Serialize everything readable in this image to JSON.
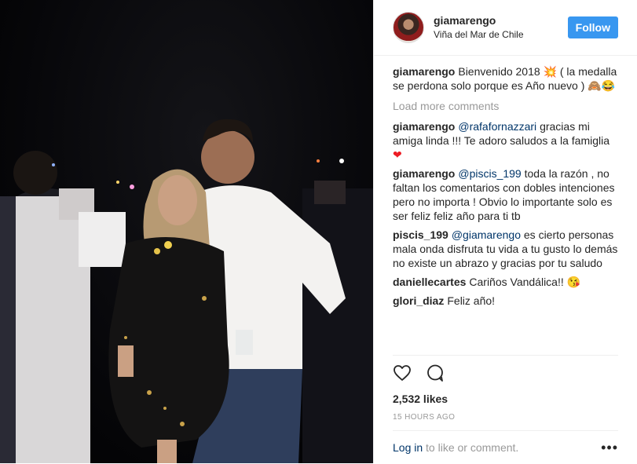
{
  "header": {
    "username": "giamarengo",
    "location": "Viña del Mar de Chile",
    "follow_label": "Follow"
  },
  "caption": {
    "username": "giamarengo",
    "text": "Bienvenido 2018 💥 ( la medalla se perdona solo porque es Año nuevo ) 🙈😂"
  },
  "load_more": "Load more comments",
  "comments": [
    {
      "username": "giamarengo",
      "mention": "@rafafornazzari",
      "text": "gracias mi amiga linda !!! Te adoro saludos a la famiglia",
      "emoji": "❤"
    },
    {
      "username": "giamarengo",
      "mention": "@piscis_199",
      "text": "toda la razón , no faltan los comentarios con dobles intenciones pero no importa ! Obvio lo importante solo es ser feliz feliz año para ti tb"
    },
    {
      "username": "piscis_199",
      "mention": "@giamarengo",
      "text": "es cierto personas mala onda disfruta tu vida a tu gusto lo demás no existe un abrazo y gracias por tu saludo"
    },
    {
      "username": "daniellecartes",
      "text": "Cariños Vandálica!! 😘"
    },
    {
      "username": "glori_diaz",
      "text": "Feliz año!"
    }
  ],
  "likes": "2,532 likes",
  "time_ago": "15 HOURS AGO",
  "footer": {
    "login_label": "Log in",
    "rest_text": " to like or comment.",
    "more_label": "•••"
  },
  "icons": {
    "like": "heart-icon",
    "comment": "comment-icon",
    "more": "more-options-icon"
  }
}
